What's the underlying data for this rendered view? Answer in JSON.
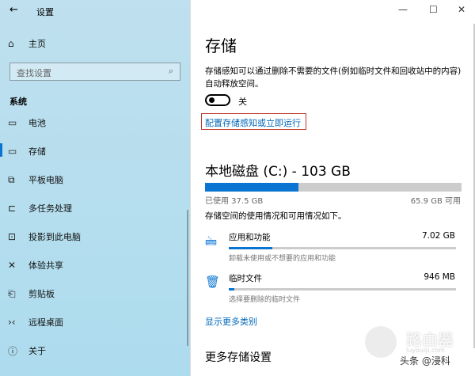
{
  "window": {
    "title": "设置",
    "minimize": "—",
    "maximize": "☐",
    "close": "✕"
  },
  "sidebar": {
    "home": "主页",
    "search_placeholder": "查找设置",
    "section": "系统",
    "items": [
      {
        "label": "电池",
        "icon": "battery-icon"
      },
      {
        "label": "存储",
        "icon": "storage-icon",
        "active": true
      },
      {
        "label": "平板电脑",
        "icon": "tablet-icon"
      },
      {
        "label": "多任务处理",
        "icon": "multitask-icon"
      },
      {
        "label": "投影到此电脑",
        "icon": "project-icon"
      },
      {
        "label": "体验共享",
        "icon": "share-icon"
      },
      {
        "label": "剪贴板",
        "icon": "clipboard-icon"
      },
      {
        "label": "远程桌面",
        "icon": "remote-desktop-icon"
      },
      {
        "label": "关于",
        "icon": "info-icon"
      }
    ]
  },
  "main": {
    "title": "存储",
    "description": "存储感知可以通过删除不需要的文件(例如临时文件和回收站中的内容)自动释放空间。",
    "toggle_state": "关",
    "configure_link": "配置存储感知或立即运行",
    "disk": {
      "title": "本地磁盘 (C:) - 103 GB",
      "used": "已使用 37.5 GB",
      "free": "65.9 GB 可用",
      "used_fraction": 0.364
    },
    "usage_caption": "存储空间的使用情况和可用情况如下。",
    "categories": [
      {
        "name": "应用和功能",
        "size": "7.02 GB",
        "sub": "卸载未使用或不想要的应用和功能",
        "fraction": 0.19
      },
      {
        "name": "临时文件",
        "size": "946 MB",
        "sub": "选择要删除的临时文件",
        "fraction": 0.025
      }
    ],
    "show_more": "显示更多类别",
    "more_settings": "更多存储设置"
  },
  "watermark": {
    "logo": "路由器",
    "site": "luyouqi.com",
    "credit": "头条 @浸科"
  },
  "colors": {
    "accent": "#0a74d2",
    "link": "#0067b8",
    "highlight_box": "#c0392b"
  }
}
